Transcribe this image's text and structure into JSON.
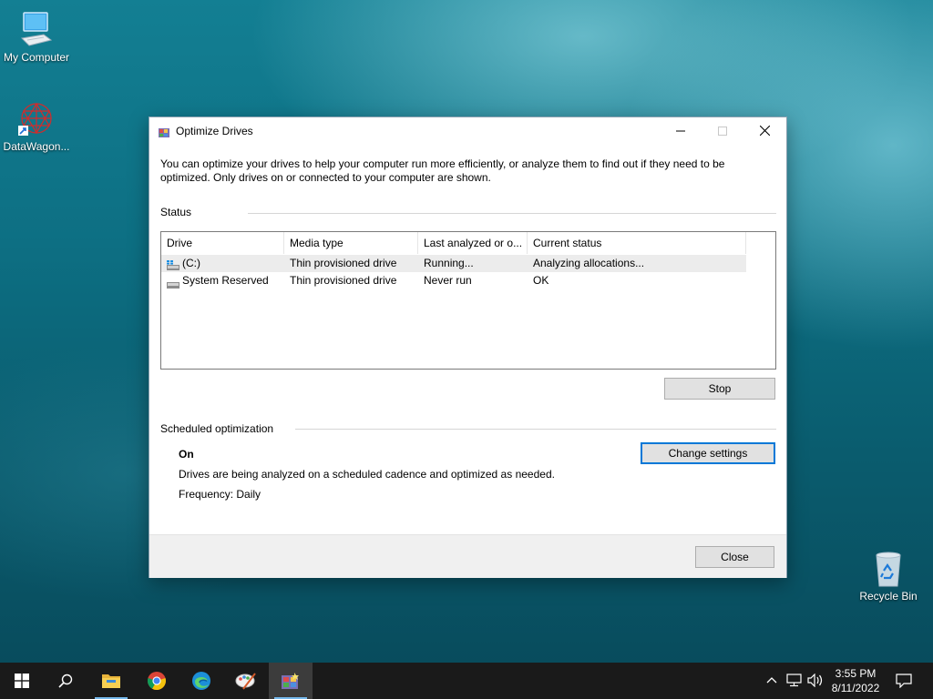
{
  "desktop": {
    "icons": [
      {
        "label": "My Computer",
        "icon": "computer-icon"
      },
      {
        "label": "DataWagon...",
        "icon": "datawagon-shortcut-icon"
      },
      {
        "label": "Recycle Bin",
        "icon": "recycle-bin-icon"
      }
    ]
  },
  "window": {
    "title": "Optimize Drives",
    "intro": "You can optimize your drives to help your computer run more efficiently, or analyze them to find out if they need to be optimized. Only drives on or connected to your computer are shown.",
    "status_label": "Status",
    "columns": [
      "Drive",
      "Media type",
      "Last analyzed or o...",
      "Current status"
    ],
    "drives": [
      {
        "drive": "(C:)",
        "media": "Thin provisioned drive",
        "last": "Running...",
        "status": "Analyzing allocations...",
        "icon": "windows-drive-icon",
        "selected": true
      },
      {
        "drive": "System Reserved",
        "media": "Thin provisioned drive",
        "last": "Never run",
        "status": "OK",
        "icon": "drive-icon",
        "selected": false
      }
    ],
    "stop_label": "Stop",
    "scheduled_label": "Scheduled optimization",
    "schedule_state": "On",
    "schedule_desc": "Drives are being analyzed on a scheduled cadence and optimized as needed.",
    "frequency": "Frequency: Daily",
    "change_settings_label": "Change settings",
    "close_label": "Close"
  },
  "taskbar": {
    "time": "3:55 PM",
    "date": "8/11/2022",
    "items": [
      "start-icon",
      "search-icon",
      "file-explorer-icon",
      "chrome-icon",
      "edge-icon",
      "paint-app-icon",
      "optimize-drives-icon"
    ]
  },
  "colors": {
    "accent": "#0078d7",
    "taskbar": "#1a1a1a"
  }
}
